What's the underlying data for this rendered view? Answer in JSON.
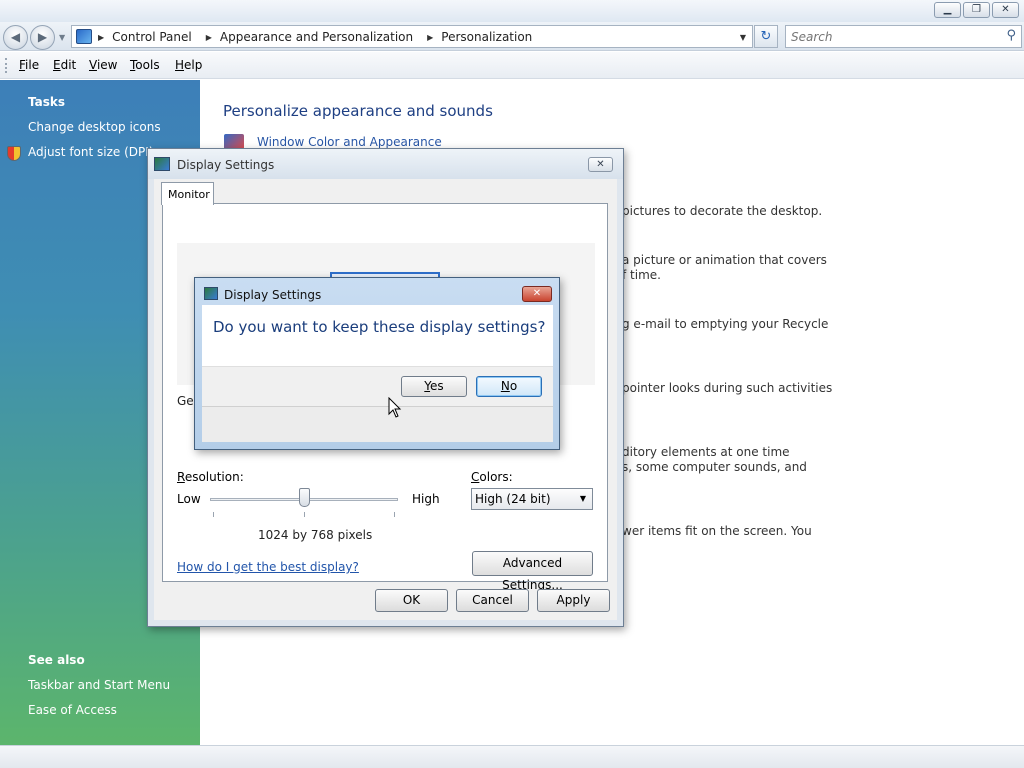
{
  "window": {
    "min_glyph": "▁",
    "max_glyph": "❐",
    "close_glyph": "✕"
  },
  "addressbar": {
    "back_glyph": "◀",
    "fwd_glyph": "▶",
    "breadcrumbs": [
      "Control Panel",
      "Appearance and Personalization",
      "Personalization"
    ],
    "refresh_glyph": "↻",
    "search_placeholder": "Search",
    "search_glyph": "⚲"
  },
  "menubar": {
    "items": [
      {
        "label": "File",
        "accel": "F"
      },
      {
        "label": "Edit",
        "accel": "E"
      },
      {
        "label": "View",
        "accel": "V"
      },
      {
        "label": "Tools",
        "accel": "T"
      },
      {
        "label": "Help",
        "accel": "H"
      }
    ]
  },
  "taskpane": {
    "tasks_heading": "Tasks",
    "tasks": [
      "Change desktop icons",
      "Adjust font size (DPI)"
    ],
    "seealso_heading": "See also",
    "seealso": [
      "Taskbar and Start Menu",
      "Ease of Access"
    ]
  },
  "content": {
    "title": "Personalize appearance and sounds",
    "first_link": "Window Color and Appearance",
    "fragments": [
      "pictures to decorate the desktop.",
      "a picture or animation that covers",
      "f time.",
      "g e-mail to emptying your Recycle",
      "pointer looks during such activities",
      "ditory elements at one time",
      "s, some computer sounds, and",
      "wer items fit on the screen. You"
    ]
  },
  "display_dialog": {
    "title": "Display Settings",
    "close_glyph": "✕",
    "tab": "Monitor",
    "gen_fragment": "Gen",
    "resolution_label": "Resolution:",
    "low": "Low",
    "high": "High",
    "resolution_value": "1024 by 768 pixels",
    "slider_position_fraction": 0.5,
    "colors_label": "Colors:",
    "colors_value": "High (24 bit)",
    "help_link": "How do I get the best display?",
    "advanced_button": "Advanced Settings...",
    "ok": "OK",
    "cancel": "Cancel",
    "apply": "Apply"
  },
  "confirm_dialog": {
    "title": "Display Settings",
    "close_glyph": "✕",
    "message": "Do you want to keep these display settings?",
    "yes": "Yes",
    "no": "No"
  },
  "colors": {
    "title_blue": "#1e3f83",
    "link_blue": "#2856a6",
    "close_red": "#c9442f"
  }
}
